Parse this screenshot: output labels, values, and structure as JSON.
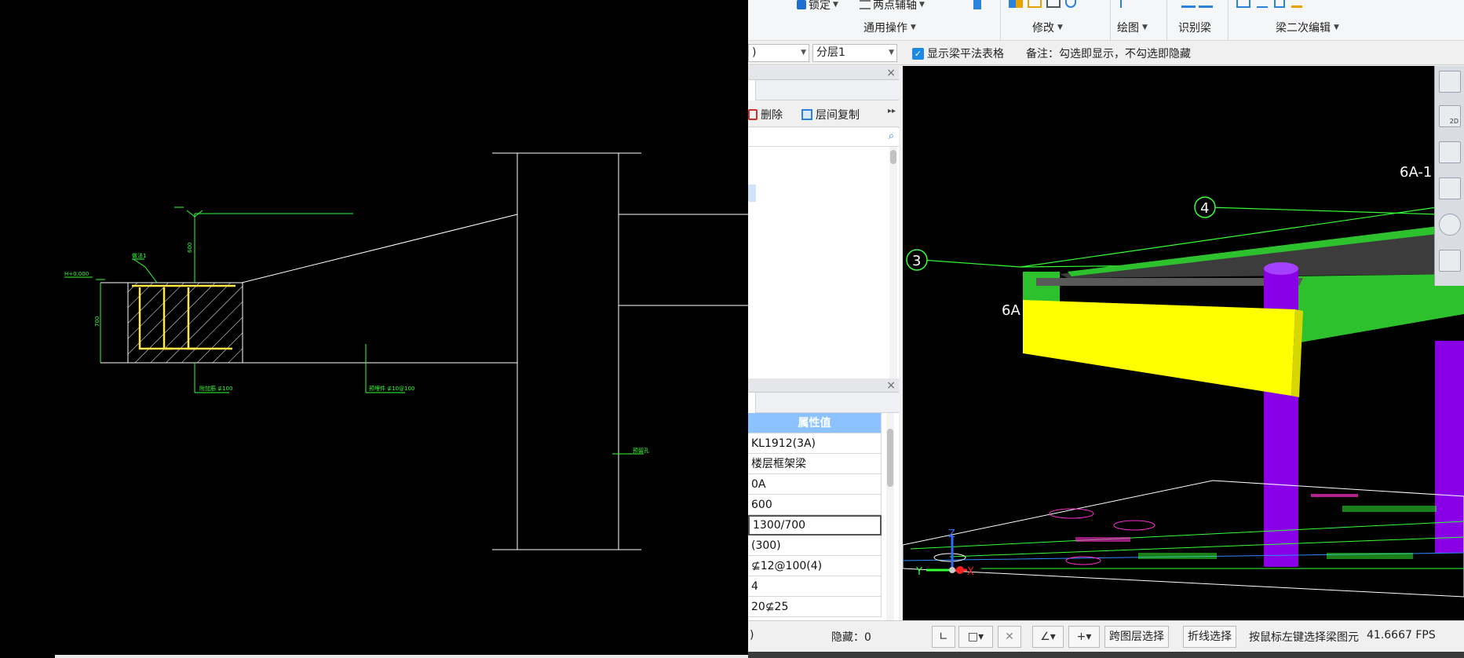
{
  "ribbon": {
    "lock_label": "锁定",
    "two_point_label": "两点辅轴",
    "general_ops_label": "通用操作",
    "modify_label": "修改",
    "draw_label": "绘图",
    "identify_beam_label": "识别梁",
    "beam_secondary_label": "梁二次编辑"
  },
  "options_bar": {
    "combo_left_value": ")",
    "layer_value": "分层1",
    "show_table_label": "显示梁平法表格",
    "note_text": "备注：勾选即显示，不勾选即隐藏"
  },
  "panel": {
    "delete_label": "删除",
    "copy_between_floors_label": "层间复制"
  },
  "properties": {
    "header": "属性值",
    "values": [
      "KL1912(3A)",
      "楼层框架梁",
      "0A",
      "600",
      "1300/700",
      "(300)",
      "⊈12@100(4)",
      "4",
      "20⊈25"
    ]
  },
  "view3d": {
    "axis_labels": [
      "6A-1",
      "4",
      "3",
      "6A"
    ],
    "triad_labels": {
      "z": "Z",
      "y": "Y",
      "x": "X"
    },
    "tool_2d_label": "2D"
  },
  "status_bar": {
    "left_fragment": ")",
    "hidden_label": "隐藏：0",
    "cross_layer_label": "跨图层选择",
    "polyline_select_label": "折线选择",
    "hint_text": "按鼠标左键选择梁图元",
    "fps_text": "41.6667 FPS"
  },
  "cad": {
    "dim_labels": [
      "600",
      "700"
    ],
    "elev_label": "H+0.000",
    "leader_labels": [
      "做法1",
      "附加筋 ⊈100",
      "预埋件 ⊈10@100",
      "预留孔"
    ]
  },
  "colors": {
    "beam_green": "#2ec12e",
    "beam_yellow": "#ffff00",
    "column_purple": "#8a00e6",
    "header_blue": "#8cc2ff",
    "cad_line": "#ffffff",
    "cad_rebar": "#ffe84a",
    "cad_annot": "#35ff35"
  }
}
